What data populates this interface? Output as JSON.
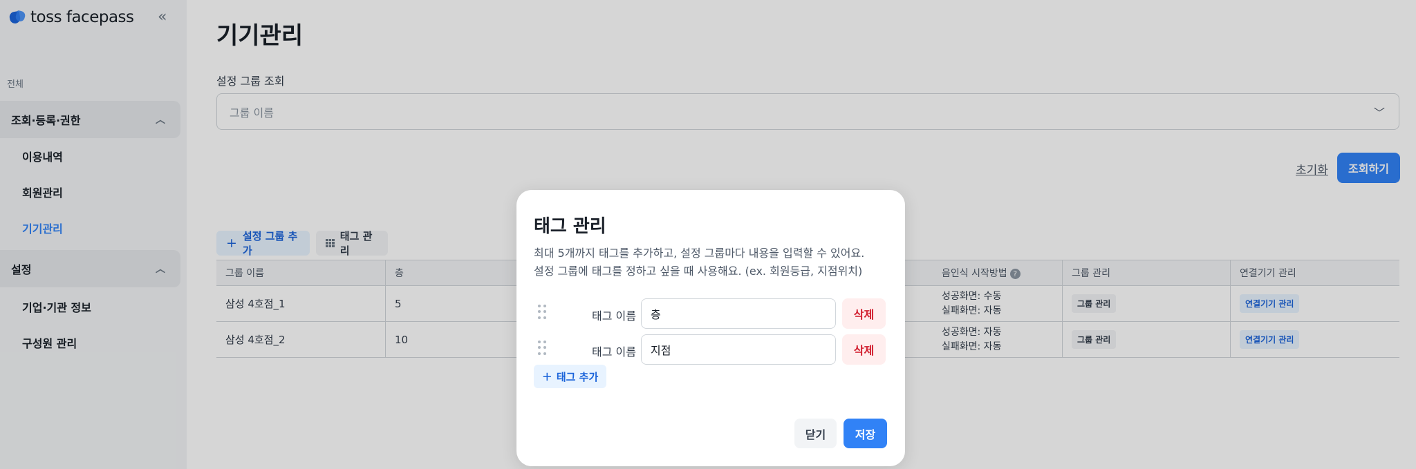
{
  "app": {
    "logo_text": "toss facepass"
  },
  "sidebar": {
    "section_label": "전체",
    "groups": [
      {
        "label": "조회·등록·권한",
        "items": [
          "이용내역",
          "회원관리",
          "기기관리"
        ]
      },
      {
        "label": "설정",
        "items": [
          "기업·기관 정보",
          "구성원 관리"
        ]
      }
    ],
    "active_item": "기기관리"
  },
  "main": {
    "title": "기기관리",
    "filter_label": "설정 그룹 조회",
    "filter_placeholder": "그룹 이름",
    "reset_label": "초기화",
    "search_label": "조회하기",
    "add_group_label": "설정 그룹 추가",
    "tag_manage_label": "태그 관리",
    "table": {
      "columns": [
        "그룹 이름",
        "층",
        "",
        "음인식 시작방법",
        "그룹 관리",
        "연결기기 관리"
      ],
      "rows": [
        {
          "name": "삼성 4호점_1",
          "floor": "5",
          "start_success": "성공화면: 수동",
          "start_fail": "실패화면: 자동",
          "group_btn": "그룹 관리",
          "device_btn": "연결기기 관리"
        },
        {
          "name": "삼성 4호점_2",
          "floor": "10",
          "start_success": "성공화면: 자동",
          "start_fail": "실패화면: 자동",
          "group_btn": "그룹 관리",
          "device_btn": "연결기기 관리"
        }
      ]
    }
  },
  "modal": {
    "title": "태그 관리",
    "desc_line1": "최대 5개까지 태그를 추가하고, 설정 그룹마다 내용을 입력할 수 있어요.",
    "desc_line2": "설정 그룹에 태그를 정하고 싶을 때 사용해요. (ex. 회원등급, 지점위치)",
    "tags": [
      {
        "label": "태그 이름",
        "value": "층",
        "delete": "삭제"
      },
      {
        "label": "태그 이름",
        "value": "지점",
        "delete": "삭제"
      }
    ],
    "add_tag_label": "태그 추가",
    "close_label": "닫기",
    "save_label": "저장"
  },
  "colors": {
    "accent": "#3182f6",
    "danger": "#d22030",
    "sidebar_bg": "#f2f4f6"
  },
  "icons": [
    "logo-mark-icon",
    "collapse-sidebar-icon",
    "chevron-up-icon",
    "chevron-down-icon",
    "plus-icon",
    "grid-icon",
    "help-icon",
    "drag-handle-icon"
  ]
}
